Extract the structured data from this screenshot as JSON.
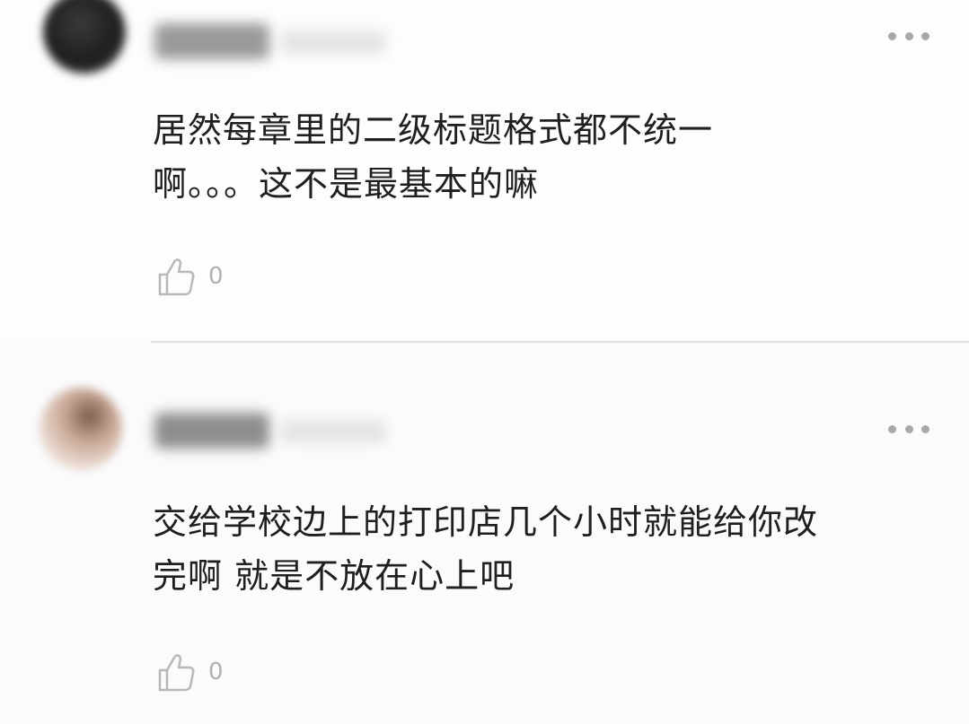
{
  "comments": [
    {
      "text_lines": [
        "居然每章里的二级标题格式都不统一",
        "啊。。。这不是最基本的嘛"
      ],
      "like_count": "0"
    },
    {
      "text_lines": [
        "交给学校边上的打印店几个小时就能给你改",
        "完啊 就是不放在心上吧"
      ],
      "like_count": "0"
    }
  ],
  "icons": {
    "more": "more-dots-icon",
    "like": "thumbs-up-icon"
  },
  "colors": {
    "text": "#1f1f1f",
    "muted": "#b0b0b0",
    "divider": "#e2e2e2"
  }
}
